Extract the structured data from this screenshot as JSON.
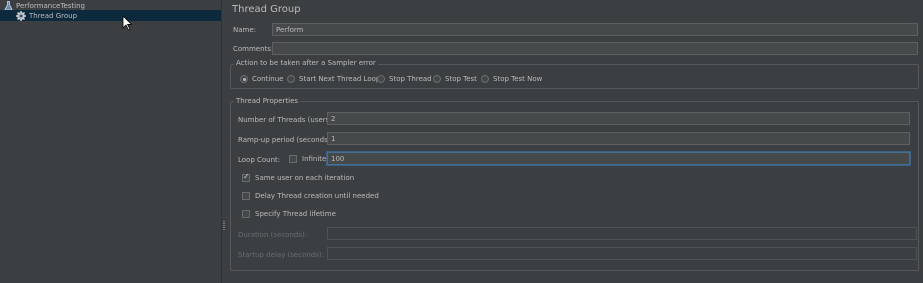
{
  "tree": {
    "root_label": "PerformanceTesting",
    "root_icon": "flask-icon",
    "child_label": "Thread Group",
    "child_icon": "gear-icon"
  },
  "form": {
    "title": "Thread Group",
    "name_label": "Name:",
    "name_value": "Perform",
    "comments_label": "Comments:",
    "comments_value": "",
    "sampler_error": {
      "title": "Action to be taken after a Sampler error",
      "options": [
        "Continue",
        "Start Next Thread Loop",
        "Stop Thread",
        "Stop Test",
        "Stop Test Now"
      ],
      "selected": "Continue"
    },
    "thread_props": {
      "title": "Thread Properties",
      "threads_label": "Number of Threads (users):",
      "threads_value": "2",
      "rampup_label": "Ramp-up period (seconds):",
      "rampup_value": "1",
      "loop_label": "Loop Count:",
      "infinite_label": "Infinite",
      "infinite_checked": false,
      "loop_value": "100",
      "same_user_label": "Same user on each iteration",
      "same_user_checked": true,
      "delay_label": "Delay Thread creation until needed",
      "delay_checked": false,
      "lifetime_label": "Specify Thread lifetime",
      "lifetime_checked": false,
      "duration_label": "Duration (seconds):",
      "duration_value": "",
      "startup_label": "Startup delay (seconds):",
      "startup_value": ""
    }
  },
  "colors": {
    "background": "#3c3f41",
    "selection": "#0d293e",
    "field": "#45494a",
    "text": "#bbbbbb",
    "focus_border": "#466d94"
  }
}
